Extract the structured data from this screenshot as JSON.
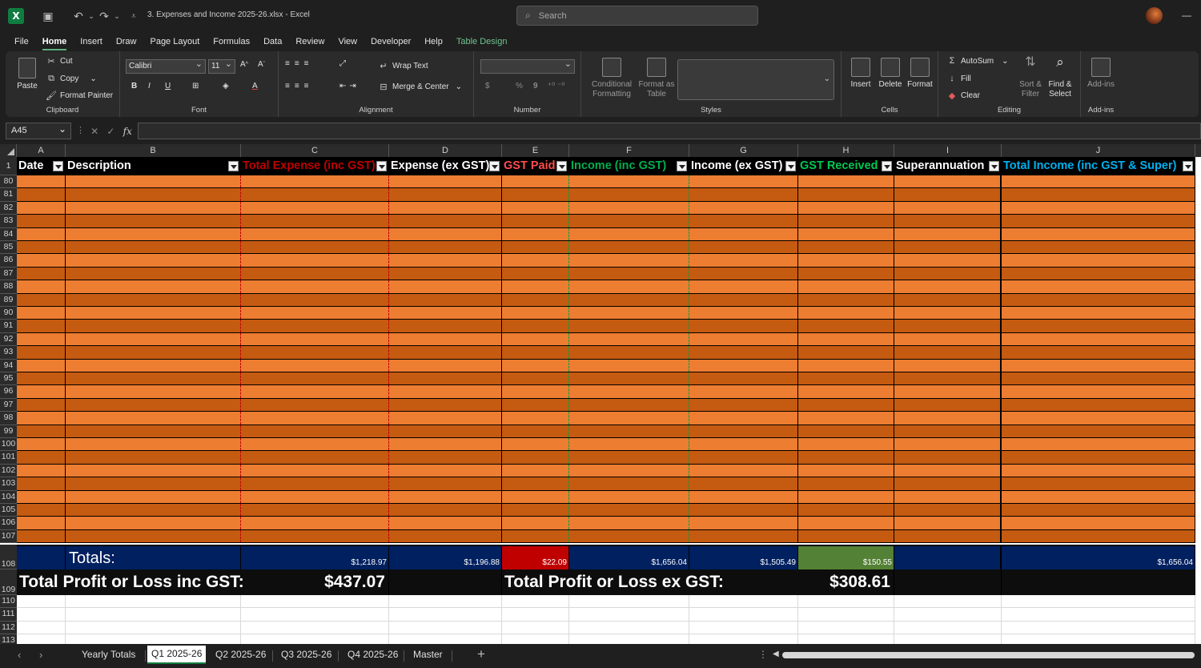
{
  "titlebar": {
    "filename": "3. Expenses and Income 2025-26.xlsx",
    "separator": " - ",
    "app": "Excel",
    "search_placeholder": "Search",
    "icons": [
      "excel-logo",
      "save-icon",
      "undo-icon",
      "redo-icon",
      "customize-icon",
      "search-icon",
      "avatar",
      "minimize-icon"
    ]
  },
  "menu": [
    "File",
    "Home",
    "Insert",
    "Draw",
    "Page Layout",
    "Formulas",
    "Data",
    "Review",
    "View",
    "Developer",
    "Help",
    "Table Design"
  ],
  "ribbon": {
    "clipboard": {
      "label": "Clipboard",
      "paste": "Paste",
      "cut": "Cut",
      "copy": "Copy",
      "format_painter": "Format Painter"
    },
    "font": {
      "label": "Font",
      "name": "Calibri",
      "size": "11",
      "bold": "B",
      "italic": "I",
      "underline": "U"
    },
    "alignment": {
      "label": "Alignment",
      "wrap": "Wrap Text",
      "merge": "Merge & Center"
    },
    "number": {
      "label": "Number",
      "format": "",
      "currency": "$",
      "percent": "%",
      "comma": "9"
    },
    "styles": {
      "label": "Styles",
      "conditional_1": "Conditional",
      "conditional_2": "Formatting",
      "format_as_1": "Format as",
      "format_as_2": "Table"
    },
    "cells": {
      "label": "Cells",
      "insert": "Insert",
      "delete": "Delete",
      "format": "Format"
    },
    "editing": {
      "label": "Editing",
      "autosum": "AutoSum",
      "fill": "Fill",
      "clear": "Clear",
      "sort_1": "Sort &",
      "sort_2": "Filter",
      "find_1": "Find &",
      "find_2": "Select"
    },
    "addins": {
      "label": "Add-ins",
      "addins": "Add-ins"
    }
  },
  "formula_bar": {
    "name_box": "A45",
    "fx": "fx",
    "formula": ""
  },
  "columns": [
    "A",
    "B",
    "C",
    "D",
    "E",
    "F",
    "G",
    "H",
    "I",
    "J"
  ],
  "headers": [
    "Date",
    "Description",
    "Total Expense (inc GST)",
    "Expense (ex GST)",
    "GST Paid",
    "Income (inc GST)",
    "Income (ex GST)",
    "GST Received",
    "Superannuation",
    "Total Income (inc GST & Super)"
  ],
  "header_colors": [
    "#ffffff",
    "#ffffff",
    "#c00000",
    "#ffffff",
    "#ff4d4d",
    "#00b050",
    "#ffffff",
    "#00c853",
    "#ffffff",
    "#00b0f0"
  ],
  "row_numbers": [
    "1",
    "80",
    "81",
    "82",
    "83",
    "84",
    "85",
    "86",
    "87",
    "88",
    "89",
    "90",
    "91",
    "92",
    "93",
    "94",
    "95",
    "96",
    "97",
    "98",
    "99",
    "100",
    "101",
    "102",
    "103",
    "104",
    "105",
    "106",
    "107",
    "108",
    "109",
    "110",
    "111",
    "112",
    "113"
  ],
  "totals": {
    "label": "Totals:",
    "values": [
      "$1,218.97",
      "$1,196.88",
      "$22.09",
      "$1,656.04",
      "$1,505.49",
      "$150.55",
      "",
      "$1,656.04"
    ]
  },
  "profit": {
    "inc_label": "Total Profit or Loss inc GST:",
    "inc_value": "$437.07",
    "ex_label": "Total Profit or Loss ex GST:",
    "ex_value": "$308.61"
  },
  "sheets": [
    "Yearly Totals",
    "Q1 2025-26",
    "Q2 2025-26",
    "Q3 2025-26",
    "Q4 2025-26",
    "Master"
  ],
  "colors": {
    "band_light": "#ed7d31",
    "band_dark": "#c55a11",
    "totals_bg": "#002060",
    "gst_paid_bg": "#c00000",
    "gst_received_bg": "#538135",
    "profit_bg": "#0d0d0d"
  }
}
